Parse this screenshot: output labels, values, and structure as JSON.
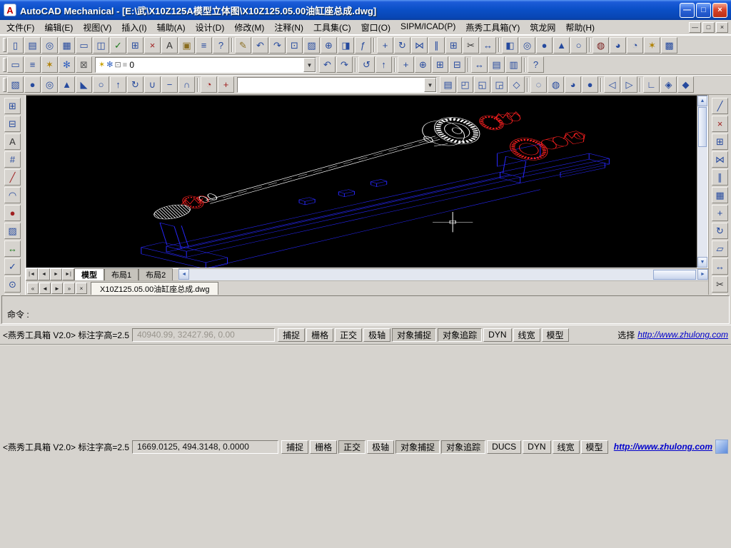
{
  "titlebar": {
    "icon_glyph": "A",
    "title": "AutoCAD Mechanical - [E:\\武\\X10Z125A模型立体图\\X10Z125.05.00油缸座总成.dwg]",
    "buttons": [
      {
        "name": "minimize",
        "glyph": "—"
      },
      {
        "name": "maximize",
        "glyph": "□"
      },
      {
        "name": "close",
        "glyph": "×"
      }
    ]
  },
  "menubar": {
    "items": [
      {
        "name": "file",
        "label": "文件(F)"
      },
      {
        "name": "edit",
        "label": "编辑(E)"
      },
      {
        "name": "view",
        "label": "视图(V)"
      },
      {
        "name": "insert",
        "label": "插入(I)"
      },
      {
        "name": "assist",
        "label": "辅助(A)"
      },
      {
        "name": "design",
        "label": "设计(D)"
      },
      {
        "name": "modify",
        "label": "修改(M)"
      },
      {
        "name": "annotate",
        "label": "注释(N)"
      },
      {
        "name": "toolsets",
        "label": "工具集(C)"
      },
      {
        "name": "window",
        "label": "窗口(O)"
      },
      {
        "name": "sipm-icad",
        "label": "SIPM/ICAD(P)"
      },
      {
        "name": "yanxiu-toolbox",
        "label": "燕秀工具箱(Y)"
      },
      {
        "name": "zhulong",
        "label": "筑龙网"
      },
      {
        "name": "help",
        "label": "帮助(H)"
      }
    ],
    "window_buttons": [
      {
        "name": "child-minimize",
        "glyph": "—"
      },
      {
        "name": "child-restore",
        "glyph": "□"
      },
      {
        "name": "child-close",
        "glyph": "×"
      }
    ]
  },
  "toolbar1": {
    "items": [
      {
        "type": "grip",
        "name": "grip"
      },
      {
        "name": "new",
        "glyph": "▯"
      },
      {
        "name": "open",
        "glyph": "▤"
      },
      {
        "name": "find",
        "glyph": "◎"
      },
      {
        "name": "save",
        "glyph": "▦"
      },
      {
        "name": "plot",
        "glyph": "▭"
      },
      {
        "name": "plot-preview",
        "glyph": "◫"
      },
      {
        "name": "spell-check",
        "glyph": "✓",
        "color": "#1d7a1d"
      },
      {
        "name": "sheet-set",
        "glyph": "⊞"
      },
      {
        "name": "erase",
        "glyph": "×",
        "color": "#a02020"
      },
      {
        "name": "text",
        "glyph": "A",
        "color": "#333333"
      },
      {
        "name": "folder",
        "glyph": "▣",
        "color": "#8a6d1f"
      },
      {
        "name": "palette",
        "glyph": "≡"
      },
      {
        "name": "help",
        "glyph": "?"
      },
      {
        "type": "sep",
        "name": "sep1"
      },
      {
        "name": "match-properties",
        "glyph": "✎",
        "color": "#8a6d1f"
      },
      {
        "name": "undo",
        "glyph": "↶"
      },
      {
        "name": "redo",
        "glyph": "↷"
      },
      {
        "name": "insert-block",
        "glyph": "⊡"
      },
      {
        "name": "hatch",
        "glyph": "▨"
      },
      {
        "name": "xref",
        "glyph": "⊕"
      },
      {
        "name": "layout",
        "glyph": "◨"
      },
      {
        "name": "fields",
        "glyph": "ƒ"
      },
      {
        "type": "sep",
        "name": "sep2"
      },
      {
        "name": "move",
        "glyph": "+"
      },
      {
        "name": "rotate",
        "glyph": "↻"
      },
      {
        "name": "mirror",
        "glyph": "⋈"
      },
      {
        "name": "offset",
        "glyph": "∥"
      },
      {
        "name": "array",
        "glyph": "⊞"
      },
      {
        "name": "trim",
        "glyph": "✂",
        "color": "#333333"
      },
      {
        "name": "extend",
        "glyph": "↔"
      },
      {
        "type": "sep",
        "name": "sep3"
      },
      {
        "name": "box-3d",
        "glyph": "◧"
      },
      {
        "name": "cylinder-3d",
        "glyph": "◎"
      },
      {
        "name": "sphere-3d",
        "glyph": "●"
      },
      {
        "name": "cone-3d",
        "glyph": "▲"
      },
      {
        "name": "torus-3d",
        "glyph": "○"
      },
      {
        "type": "sep",
        "name": "sep4"
      },
      {
        "name": "render",
        "glyph": "◍",
        "color": "#7a2020"
      },
      {
        "name": "shade",
        "glyph": "◕"
      },
      {
        "name": "orbit-3d",
        "glyph": "◔"
      },
      {
        "name": "light",
        "glyph": "✶",
        "color": "#b08000"
      },
      {
        "name": "materials",
        "glyph": "▩"
      }
    ]
  },
  "toolbar2": {
    "left": [
      {
        "type": "grip",
        "name": "grip"
      },
      {
        "name": "clean-screen",
        "glyph": "▭"
      },
      {
        "name": "layer-properties",
        "glyph": "≡"
      },
      {
        "name": "layer-on",
        "glyph": "✶",
        "color": "#b08000"
      },
      {
        "name": "layer-freeze",
        "glyph": "✻",
        "color": "#3060c0"
      },
      {
        "name": "layer-lock",
        "glyph": "⊠",
        "color": "#555555"
      }
    ],
    "combo": {
      "value": "0",
      "state_icons": [
        {
          "name": "on",
          "glyph": "✶",
          "color": "#c8a000"
        },
        {
          "name": "freeze",
          "glyph": "✻",
          "color": "#3060c0"
        },
        {
          "name": "lock",
          "glyph": "⊡",
          "color": "#707070"
        },
        {
          "name": "color-swatch",
          "glyph": "■",
          "color": "#c8c8c8"
        }
      ]
    },
    "right": [
      {
        "name": "undo",
        "glyph": "↶"
      },
      {
        "name": "redo",
        "glyph": "↷"
      },
      {
        "type": "sep",
        "name": "sep1"
      },
      {
        "name": "layer-previous",
        "glyph": "↺"
      },
      {
        "name": "make-current",
        "glyph": "↑"
      },
      {
        "type": "sep",
        "name": "sep2"
      },
      {
        "name": "pan",
        "glyph": "+"
      },
      {
        "name": "zoom-realtime",
        "glyph": "⊕"
      },
      {
        "name": "zoom-window",
        "glyph": "⊞"
      },
      {
        "name": "zoom-previous",
        "glyph": "⊟"
      },
      {
        "type": "sep",
        "name": "sep3"
      },
      {
        "name": "distance",
        "glyph": "↔"
      },
      {
        "name": "list",
        "glyph": "▤"
      },
      {
        "name": "properties",
        "glyph": "▥"
      },
      {
        "type": "sep",
        "name": "sep4"
      },
      {
        "name": "help",
        "glyph": "?"
      }
    ]
  },
  "toolbar3": {
    "left": [
      {
        "type": "grip",
        "name": "grip"
      },
      {
        "name": "box",
        "glyph": "▧"
      },
      {
        "name": "sphere",
        "glyph": "●"
      },
      {
        "name": "cylinder",
        "glyph": "◎"
      },
      {
        "name": "cone",
        "glyph": "▲"
      },
      {
        "name": "wedge",
        "glyph": "◣"
      },
      {
        "name": "torus",
        "glyph": "○"
      },
      {
        "name": "extrude",
        "glyph": "↑"
      },
      {
        "name": "revolve",
        "glyph": "↻"
      },
      {
        "name": "union",
        "glyph": "∪"
      },
      {
        "name": "subtract",
        "glyph": "−"
      },
      {
        "name": "intersect",
        "glyph": "∩"
      },
      {
        "type": "sep",
        "name": "sep1"
      },
      {
        "name": "orbit-3d",
        "glyph": "◔",
        "color": "#a02020"
      },
      {
        "name": "pan-3d",
        "glyph": "+",
        "color": "#a02020"
      }
    ],
    "combo": {
      "value": ""
    },
    "right": [
      {
        "name": "named-views",
        "glyph": "▤"
      },
      {
        "name": "top-view",
        "glyph": "◰"
      },
      {
        "name": "front-view",
        "glyph": "◱"
      },
      {
        "name": "right-view",
        "glyph": "◲"
      },
      {
        "name": "iso-view",
        "glyph": "◇"
      },
      {
        "type": "sep",
        "name": "sep1"
      },
      {
        "name": "wireframe",
        "glyph": "◌"
      },
      {
        "name": "hidden",
        "glyph": "◍"
      },
      {
        "name": "shaded",
        "glyph": "◕"
      },
      {
        "name": "rendered",
        "glyph": "●"
      },
      {
        "type": "sep",
        "name": "sep2"
      },
      {
        "name": "prev-view",
        "glyph": "◁"
      },
      {
        "name": "next-view",
        "glyph": "▷"
      },
      {
        "type": "sep",
        "name": "sep3"
      },
      {
        "name": "ucs",
        "glyph": "∟"
      },
      {
        "name": "ucs-world",
        "glyph": "◈"
      },
      {
        "name": "ucs-face",
        "glyph": "◆"
      }
    ]
  },
  "left_toolbar": {
    "items": [
      {
        "name": "am-content",
        "glyph": "⊞"
      },
      {
        "name": "am-library",
        "glyph": "⊟"
      },
      {
        "name": "am-text",
        "glyph": "A",
        "color": "#333333"
      },
      {
        "name": "am-construction",
        "glyph": "#"
      },
      {
        "name": "am-centerline",
        "glyph": "╱",
        "color": "#a02020"
      },
      {
        "name": "am-contour",
        "glyph": "◠"
      },
      {
        "name": "am-circle",
        "glyph": "●",
        "color": "#a02020"
      },
      {
        "name": "am-hatch",
        "glyph": "▨"
      },
      {
        "name": "am-power-dimension",
        "glyph": "↔",
        "color": "#1d7a1d"
      },
      {
        "name": "am-surface-symbol",
        "glyph": "✓"
      },
      {
        "name": "am-balloon",
        "glyph": "⊙"
      },
      {
        "name": "am-bom-list",
        "glyph": "▤"
      },
      {
        "name": "am-title-border",
        "glyph": "▦"
      },
      {
        "name": "am-invisible-lines",
        "glyph": "▩",
        "color": "#b515b5"
      }
    ]
  },
  "right_toolbar": {
    "items": [
      {
        "name": "line",
        "glyph": "╱"
      },
      {
        "name": "erase",
        "glyph": "×",
        "color": "#a02020"
      },
      {
        "name": "copy",
        "glyph": "⊞"
      },
      {
        "name": "mirror",
        "glyph": "⋈"
      },
      {
        "name": "offset",
        "glyph": "∥"
      },
      {
        "name": "array",
        "glyph": "▦"
      },
      {
        "name": "move",
        "glyph": "+"
      },
      {
        "name": "rotate",
        "glyph": "↻"
      },
      {
        "name": "scale",
        "glyph": "▱"
      },
      {
        "name": "stretch",
        "glyph": "↔"
      },
      {
        "name": "trim",
        "glyph": "✂",
        "color": "#333333"
      },
      {
        "name": "extend",
        "glyph": "↦"
      },
      {
        "name": "break",
        "glyph": "∦"
      },
      {
        "name": "chamfer",
        "glyph": "∠"
      },
      {
        "name": "fillet",
        "glyph": "◠"
      },
      {
        "name": "explode",
        "glyph": "✳",
        "color": "#a02020"
      },
      {
        "name": "undo",
        "glyph": "↶"
      },
      {
        "name": "zoom",
        "glyph": "⊕"
      },
      {
        "name": "pan",
        "glyph": "+"
      },
      {
        "name": "redraw",
        "glyph": "↺"
      }
    ]
  },
  "layout_bar": {
    "nav": [
      {
        "name": "first",
        "glyph": "|◄"
      },
      {
        "name": "prev",
        "glyph": "◄"
      },
      {
        "name": "next",
        "glyph": "►"
      },
      {
        "name": "last",
        "glyph": "►|"
      }
    ],
    "tabs": [
      {
        "name": "model",
        "label": "模型",
        "active": true
      },
      {
        "name": "layout1",
        "label": "布局1"
      },
      {
        "name": "layout2",
        "label": "布局2"
      }
    ]
  },
  "doc_bar": {
    "nav": [
      {
        "name": "first",
        "glyph": "«"
      },
      {
        "name": "prev",
        "glyph": "◄"
      },
      {
        "name": "next",
        "glyph": "►"
      },
      {
        "name": "last",
        "glyph": "»"
      },
      {
        "name": "close",
        "glyph": "×"
      }
    ],
    "tab": "X10Z125.05.00油缸座总成.dwg"
  },
  "scrollbars": {
    "up": "▲",
    "down": "▼",
    "left": "◄",
    "right": "►"
  },
  "ui": {
    "dropdown_arrow": "▼"
  },
  "command": {
    "prompt": "命令 :"
  },
  "status1": {
    "app_text": "<燕秀工具箱 V2.0> 标注字高=2.5",
    "coords": "40940.99, 32427.96, 0.00",
    "toggles": [
      {
        "name": "snap",
        "label": "捕捉"
      },
      {
        "name": "grid",
        "label": "栅格"
      },
      {
        "name": "ortho",
        "label": "正交"
      },
      {
        "name": "polar",
        "label": "极轴"
      },
      {
        "name": "osnap",
        "label": "对象捕捉",
        "pressed": true
      },
      {
        "name": "otrack",
        "label": "对象追踪",
        "pressed": true
      },
      {
        "name": "dyn",
        "label": "DYN"
      },
      {
        "name": "lwt",
        "label": "线宽"
      },
      {
        "name": "model",
        "label": "模型"
      }
    ],
    "right_text": "选择",
    "link": "http://www.zhulong.com"
  },
  "status2": {
    "app_text": "<燕秀工具箱 V2.0> 标注字高=2.5",
    "coords": "1669.0125, 494.3148, 0.0000",
    "toggles": [
      {
        "name": "snap",
        "label": "捕捉"
      },
      {
        "name": "grid",
        "label": "栅格"
      },
      {
        "name": "ortho",
        "label": "正交",
        "pressed": true
      },
      {
        "name": "polar",
        "label": "极轴"
      },
      {
        "name": "osnap",
        "label": "对象捕捉",
        "pressed": true
      },
      {
        "name": "otrack",
        "label": "对象追踪",
        "pressed": true
      },
      {
        "name": "ducs",
        "label": "DUCS"
      },
      {
        "name": "dyn",
        "label": "DYN"
      },
      {
        "name": "lwt",
        "label": "线宽"
      },
      {
        "name": "model",
        "label": "模型"
      }
    ],
    "link": "http://www.zhulong.com"
  },
  "colors": {
    "canvas": "#000000",
    "blue_lines": "#2828ff",
    "red_lines": "#ff2020",
    "white_lines": "#ffffff",
    "link": "#0000cc",
    "titlebar": "#0b50c8"
  }
}
